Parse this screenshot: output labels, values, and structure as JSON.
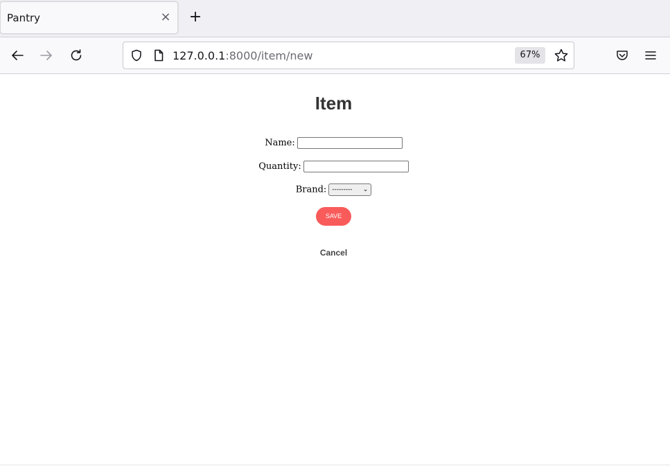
{
  "browser": {
    "tab_title": "Pantry",
    "tab_close": "×",
    "new_tab": "+",
    "url_host": "127.0.0.1",
    "url_path": ":8000/item/new",
    "zoom": "67%"
  },
  "page": {
    "title": "Item",
    "form": {
      "name_label": "Name:",
      "name_value": "",
      "quantity_label": "Quantity:",
      "quantity_value": "",
      "brand_label": "Brand:",
      "brand_selected": "---------"
    },
    "save_label": "SAVE",
    "cancel_label": "Cancel"
  },
  "colors": {
    "save_button": "#f95b5b",
    "title_text": "#333333"
  }
}
